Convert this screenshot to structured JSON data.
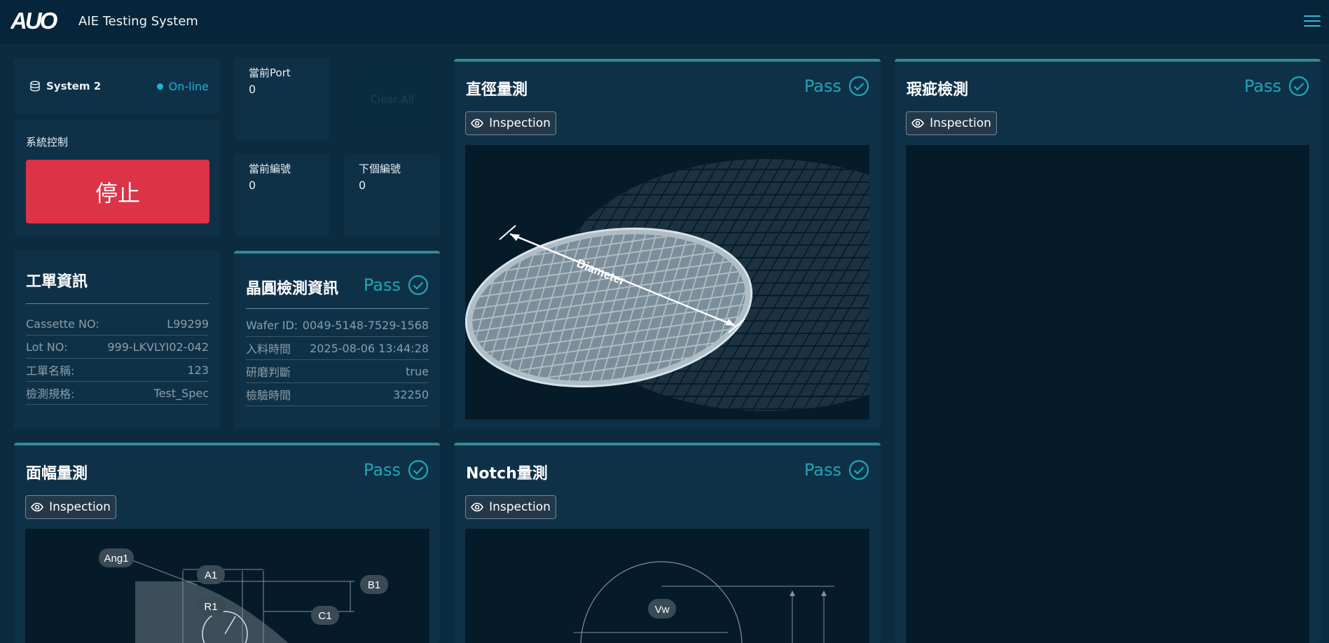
{
  "header": {
    "logo_text": "AUO",
    "title": "AIE Testing System"
  },
  "system": {
    "name": "System 2",
    "status": "On-line"
  },
  "control": {
    "label": "系統控制",
    "stop_label": "停止"
  },
  "stats": {
    "current_port_label": "當前Port",
    "current_port_value": "0",
    "clear_all_label": "Clear All",
    "current_no_label": "當前編號",
    "current_no_value": "0",
    "next_no_label": "下個編號",
    "next_no_value": "0"
  },
  "work_order": {
    "title": "工單資訊",
    "rows": [
      {
        "label": "Cassette NO:",
        "value": "L99299"
      },
      {
        "label": "Lot NO:",
        "value": "999-LKVLYI02-042"
      },
      {
        "label": "工單名稱:",
        "value": "123"
      },
      {
        "label": "檢測規格:",
        "value": "Test_Spec"
      }
    ]
  },
  "wafer_info": {
    "title": "晶圓檢測資訊",
    "result": "Pass",
    "rows": [
      {
        "label": "Wafer ID:",
        "value": "0049-5148-7529-1568"
      },
      {
        "label": "入料時間",
        "value": "2025-08-06 13:44:28"
      },
      {
        "label": "研磨判斷",
        "value": "true"
      },
      {
        "label": "檢驗時間",
        "value": "32250"
      }
    ]
  },
  "panels": {
    "diameter": {
      "title": "直徑量測",
      "result": "Pass",
      "button": "Inspection",
      "image_label": "Diameter"
    },
    "defect": {
      "title": "瑕疵檢測",
      "result": "Pass",
      "button": "Inspection"
    },
    "width": {
      "title": "面幅量測",
      "result": "Pass",
      "button": "Inspection",
      "labels": [
        "Ang1",
        "A1",
        "B1",
        "R1",
        "C1"
      ]
    },
    "notch": {
      "title": "Notch量測",
      "result": "Pass",
      "button": "Inspection",
      "labels": [
        "Vw"
      ]
    }
  },
  "colors": {
    "accent": "#1ea7b5",
    "stop": "#dd3347",
    "status": "#19b5d6"
  }
}
